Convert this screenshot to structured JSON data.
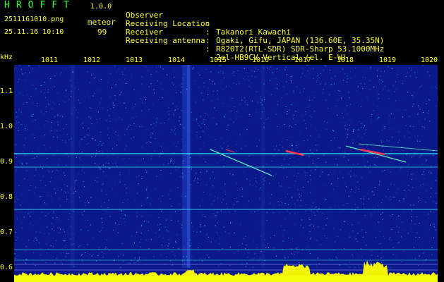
{
  "header": {
    "app_title": "HROFFT",
    "app_version": "1.0.0",
    "file_name": "2511161010.png",
    "event_type": "meteor",
    "timestamp": "25.11.16 10:10",
    "event_count": "99"
  },
  "info": [
    {
      "label": "Observer",
      "value": "Takanori Kawachi"
    },
    {
      "label": "Receiving Location",
      "value": "Ogaki, Gifu, JAPAN (136.60E, 35.35N)"
    },
    {
      "label": "Receiver",
      "value": "R820T2(RTL-SDR) SDR-Sharp 53.1000MHz"
    },
    {
      "label": "Receiving antenna",
      "value": "2el-HB9CV Vertical (el. E-W)"
    }
  ],
  "info_separator": ":",
  "plot": {
    "unit_label": "kHz",
    "x_ticks": [
      "1011",
      "1012",
      "1013",
      "1014",
      "1015",
      "1016",
      "1017",
      "1018",
      "1019",
      "1020"
    ],
    "y_ticks": [
      "1.1",
      "1.0",
      "0.9",
      "0.8",
      "0.7",
      "0.6"
    ],
    "background_color": "#0b1a8a",
    "signal_color": "#33ffff",
    "meteor_head_color": "#ff3355",
    "spectrum_color": "#ffff00",
    "baseline_color": "#00ccff"
  }
}
